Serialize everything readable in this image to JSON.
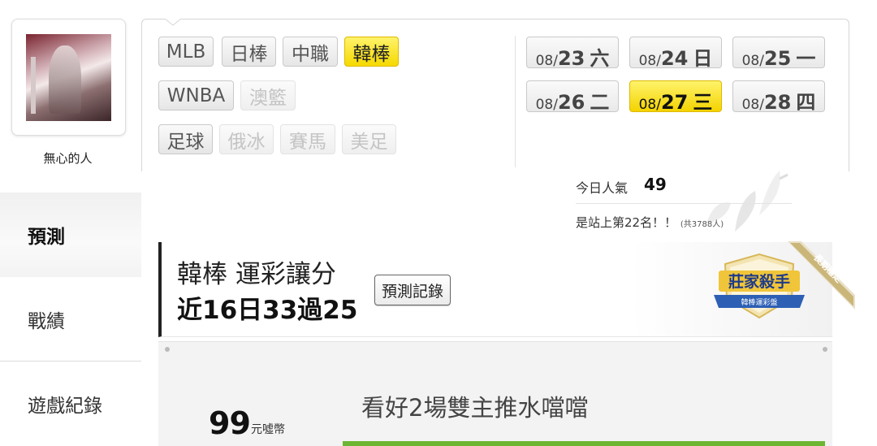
{
  "profile": {
    "username": "無心的人"
  },
  "sidebar": {
    "items": [
      {
        "label": "預測",
        "active": true
      },
      {
        "label": "戰績",
        "active": false
      },
      {
        "label": "遊戲紀錄",
        "active": false
      }
    ]
  },
  "leagues": {
    "row1": [
      {
        "label": "MLB",
        "state": "normal"
      },
      {
        "label": "日棒",
        "state": "normal"
      },
      {
        "label": "中職",
        "state": "normal"
      },
      {
        "label": "韓棒",
        "state": "active"
      }
    ],
    "row2": [
      {
        "label": "WNBA",
        "state": "normal"
      },
      {
        "label": "澳籃",
        "state": "disabled"
      }
    ],
    "row3": [
      {
        "label": "足球",
        "state": "normal"
      },
      {
        "label": "俄冰",
        "state": "disabled"
      },
      {
        "label": "賽馬",
        "state": "disabled"
      },
      {
        "label": "美足",
        "state": "disabled"
      }
    ]
  },
  "dates": [
    {
      "month": "08/",
      "day": "23",
      "weekday": "六",
      "active": false
    },
    {
      "month": "08/",
      "day": "24",
      "weekday": "日",
      "active": false
    },
    {
      "month": "08/",
      "day": "25",
      "weekday": "一",
      "active": false
    },
    {
      "month": "08/",
      "day": "26",
      "weekday": "二",
      "active": false
    },
    {
      "month": "08/",
      "day": "27",
      "weekday": "三",
      "active": true
    },
    {
      "month": "08/",
      "day": "28",
      "weekday": "四",
      "active": false
    }
  ],
  "popularity": {
    "label": "今日人氣",
    "value": "49",
    "rank_text": "是站上第22名！！",
    "rank_total": "(共3788人)"
  },
  "record": {
    "title": "韓棒 運彩讓分",
    "summary": "近16日33過25",
    "history_button": "預測記錄",
    "badge": {
      "title": "莊家殺手",
      "subtitle": "韓棒運彩盤",
      "ribbon": "長期穩定"
    }
  },
  "prediction": {
    "price": "99",
    "price_unit": "元噓幣",
    "text": "看好2場雙主推水噹噹"
  },
  "colors": {
    "active_yellow": "#f5d900",
    "accent_green": "#6cb632"
  }
}
